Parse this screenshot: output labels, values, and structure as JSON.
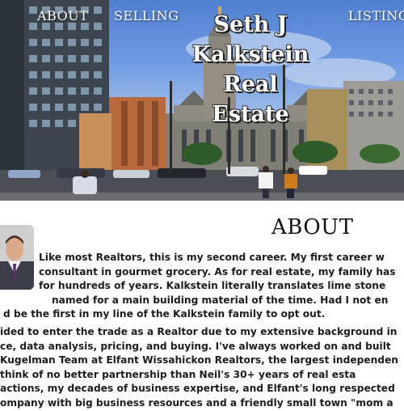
{
  "nav": {
    "about": "ABOUT",
    "selling": "SELLING",
    "listings": "LISTING"
  },
  "brand": {
    "line1": "Seth J",
    "line2": "Kalkstein",
    "line3": "Real Estate"
  },
  "about": {
    "title": "ABOUT",
    "paragraph1": [
      "Like most Realtors, this is my second career. My first career w",
      "consultant in gourmet grocery. As for real estate, my family has",
      "for hundreds of years. Kalkstein literally translates lime stone",
      "named for a main building material of the time. Had I not en",
      "d be the first in my line of the Kalkstein family to opt out."
    ],
    "paragraph2": [
      "ided to enter the trade as a Realtor due to my extensive background in",
      "ce, data analysis, pricing, and buying. I've always worked on and built",
      "Kugelman Team at Elfant Wissahickon Realtors, the largest independen",
      "think of no better partnership than Neil's 30+ years of real esta",
      "actions, my decades of business expertise, and Elfant's long respected",
      "ompany with big business resources and a friendly small town \"mom a"
    ]
  },
  "colors": {
    "sky": "#6e9ae3",
    "text": "#1d1d1d"
  }
}
